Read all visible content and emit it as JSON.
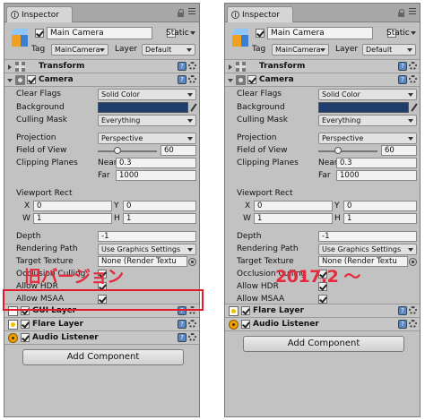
{
  "panels": [
    {
      "id": "left",
      "tab_label": "Inspector",
      "object_name": "Main Camera",
      "static_label": "Static",
      "tag_label": "Tag",
      "tag_value": "MainCamera",
      "layer_label": "Layer",
      "layer_value": "Default",
      "transform_title": "Transform",
      "camera_title": "Camera",
      "clear_flags_label": "Clear Flags",
      "clear_flags_value": "Solid Color",
      "background_label": "Background",
      "background_color": "#1f3d6b",
      "culling_mask_label": "Culling Mask",
      "culling_mask_value": "Everything",
      "projection_label": "Projection",
      "projection_value": "Perspective",
      "fov_label": "Field of View",
      "fov_value": "60",
      "fov_slider_fraction": 0.33,
      "clipping_label": "Clipping Planes",
      "near_label": "Near",
      "near_value": "0.3",
      "far_label": "Far",
      "far_value": "1000",
      "viewport_label": "Viewport Rect",
      "x_label": "X",
      "x_value": "0",
      "y_label": "Y",
      "y_value": "0",
      "w_label": "W",
      "w_value": "1",
      "h_label": "H",
      "h_value": "1",
      "depth_label": "Depth",
      "depth_value": "-1",
      "rendering_path_label": "Rendering Path",
      "rendering_path_value": "Use Graphics Settings",
      "target_texture_label": "Target Texture",
      "target_texture_value": "None (Render Textu",
      "occlusion_label": "Occlusion Culling",
      "allow_hdr_label": "Allow HDR",
      "allow_msaa_label": "Allow MSAA",
      "extra_component_title": "GUI Layer",
      "flare_title": "Flare Layer",
      "audio_title": "Audio Listener",
      "add_component_label": "Add Component",
      "overlay_label": "旧バージョン"
    },
    {
      "id": "right",
      "tab_label": "Inspector",
      "object_name": "Main Camera",
      "static_label": "Static",
      "tag_label": "Tag",
      "tag_value": "MainCamera",
      "layer_label": "Layer",
      "layer_value": "Default",
      "transform_title": "Transform",
      "camera_title": "Camera",
      "clear_flags_label": "Clear Flags",
      "clear_flags_value": "Solid Color",
      "background_label": "Background",
      "background_color": "#1f3d6b",
      "culling_mask_label": "Culling Mask",
      "culling_mask_value": "Everything",
      "projection_label": "Projection",
      "projection_value": "Perspective",
      "fov_label": "Field of View",
      "fov_value": "60",
      "fov_slider_fraction": 0.33,
      "clipping_label": "Clipping Planes",
      "near_label": "Near",
      "near_value": "0.3",
      "far_label": "Far",
      "far_value": "1000",
      "viewport_label": "Viewport Rect",
      "x_label": "X",
      "x_value": "0",
      "y_label": "Y",
      "y_value": "0",
      "w_label": "W",
      "w_value": "1",
      "h_label": "H",
      "h_value": "1",
      "depth_label": "Depth",
      "depth_value": "-1",
      "rendering_path_label": "Rendering Path",
      "rendering_path_value": "Use Graphics Settings",
      "target_texture_label": "Target Texture",
      "target_texture_value": "None (Render Textu",
      "occlusion_label": "Occlusion Culling",
      "allow_hdr_label": "Allow HDR",
      "allow_msaa_label": "Allow MSAA",
      "flare_title": "Flare Layer",
      "audio_title": "Audio Listener",
      "add_component_label": "Add Component",
      "overlay_label": "2017.2 ～"
    }
  ],
  "colors": {
    "highlight": "#e31a2c",
    "overlay_text": "#e52a3e"
  }
}
